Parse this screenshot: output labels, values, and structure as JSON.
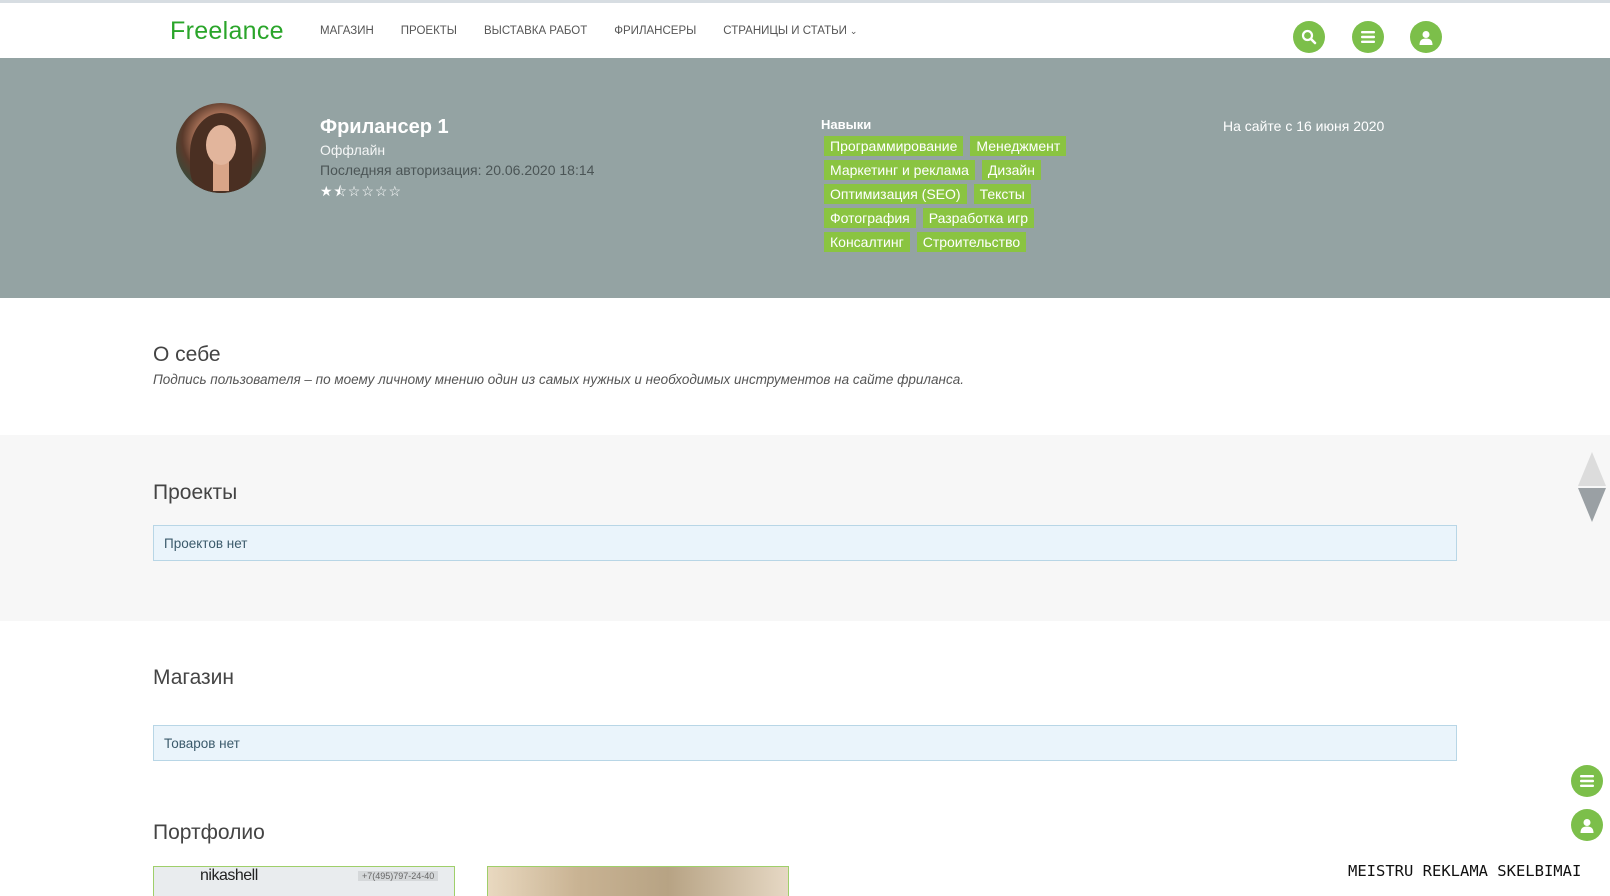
{
  "header": {
    "logo": "Freelance",
    "nav": [
      "МАГАЗИН",
      "ПРОЕКТЫ",
      "ВЫСТАВКА РАБОТ",
      "ФРИЛАНСЕРЫ",
      "СТРАНИЦЫ И СТАТЬИ"
    ],
    "icons": [
      "search-icon",
      "menu-icon",
      "user-icon"
    ],
    "accent_color": "#7cbf4a",
    "logo_color": "#2aa52a"
  },
  "profile": {
    "name": "Фрилансер 1",
    "status": "Оффлайн",
    "last_login": "Последняя авторизация: 20.06.2020 18:14",
    "rating_stars": "★⯪☆☆☆☆",
    "rating": 1.5,
    "rating_max": 6,
    "skills_title": "Навыки",
    "skills": [
      "Программирование",
      "Менеджмент",
      "Маркетинг и реклама",
      "Дизайн",
      "Оптимизация (SEO)",
      "Тексты",
      "Фотография",
      "Разработка игр",
      "Консалтинг",
      "Строительство"
    ],
    "since": "На сайте с 16 июня 2020",
    "banner_color": "#94a3a3",
    "tag_color": "#8ac441"
  },
  "about": {
    "title": "О себе",
    "text": "Подпись пользователя – по моему личному мнению один из самых нужных и необходимых инструментов на сайте фриланса."
  },
  "projects": {
    "title": "Проекты",
    "empty": "Проектов нет"
  },
  "shop": {
    "title": "Магазин",
    "empty": "Товаров нет"
  },
  "portfolio": {
    "title": "Портфолио",
    "item1_brand": "nikashell",
    "item1_phone": "+7(495)797-24-40"
  },
  "floating": {
    "ad_text": "MEISTRU REKLAMA SKELBIMAI"
  }
}
